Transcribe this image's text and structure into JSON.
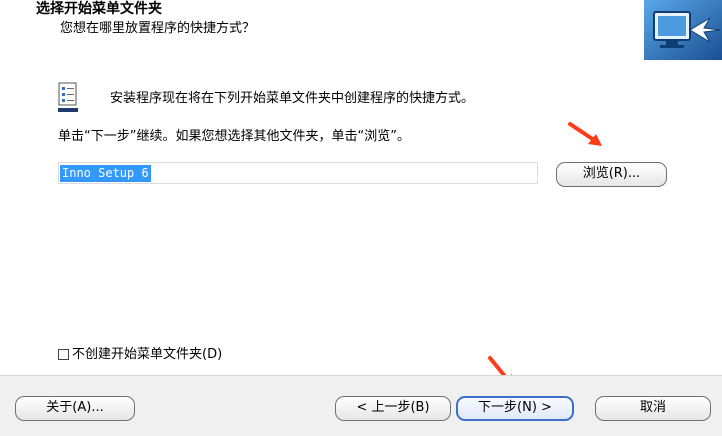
{
  "header": {
    "title": "选择开始菜单文件夹",
    "subtitle": "您想在哪里放置程序的快捷方式？"
  },
  "body": {
    "info_text": "安装程序现在将在下列开始菜单文件夹中创建程序的快捷方式。",
    "instruction_text": "单击“下一步”继续。如果您想选择其他文件夹，单击“浏览”。",
    "folder_value": "Inno Setup 6",
    "browse_label": "浏览(R)...",
    "no_folder_checkbox_label": "不创建开始菜单文件夹(D)"
  },
  "footer": {
    "about_label": "关于(A)...",
    "back_label": "< 上一步(B)",
    "next_label": "下一步(N) >",
    "cancel_label": "取消"
  },
  "colors": {
    "accent": "#3399ff",
    "arrow": "#ff3b1a",
    "focus_border": "#3a70c8"
  }
}
